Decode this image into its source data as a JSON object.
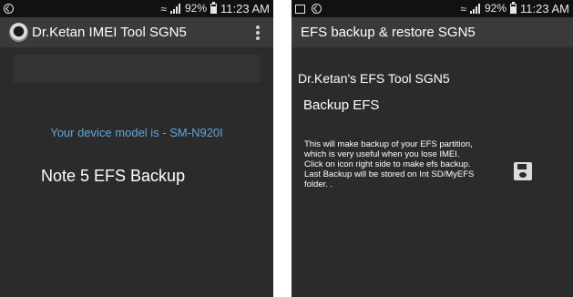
{
  "left_screen": {
    "status_bar": {
      "battery": "92%",
      "time": "11:23 AM"
    },
    "action_bar": {
      "title": "Dr.Ketan IMEI Tool SGN5"
    },
    "device_model": "Your device model is - SM-N920I",
    "backup_button": "Note 5 EFS Backup"
  },
  "right_screen": {
    "status_bar": {
      "battery": "92%",
      "time": "11:23 AM"
    },
    "action_bar": {
      "title": "EFS backup & restore SGN5"
    },
    "tool_title": "Dr.Ketan's EFS Tool SGN5",
    "backup_heading": "Backup EFS",
    "description": [
      "This will make backup of your EFS partition,",
      "which is very useful when you lose IMEI.",
      "Click on icon right side to make efs backup.",
      "Last Backup will be stored on Int SD/MyEFS",
      "folder. ."
    ]
  },
  "colors": {
    "screen_bg": "#2b2b2b",
    "status_bar_bg": "#111111",
    "action_bar_bg": "#3a3a3a",
    "accent_text": "#5fa8dd"
  },
  "icons": [
    "sync-icon",
    "gallery-icon",
    "wifi-icon",
    "signal-icon",
    "battery-icon",
    "app-icon",
    "overflow-menu-icon",
    "save-icon"
  ]
}
